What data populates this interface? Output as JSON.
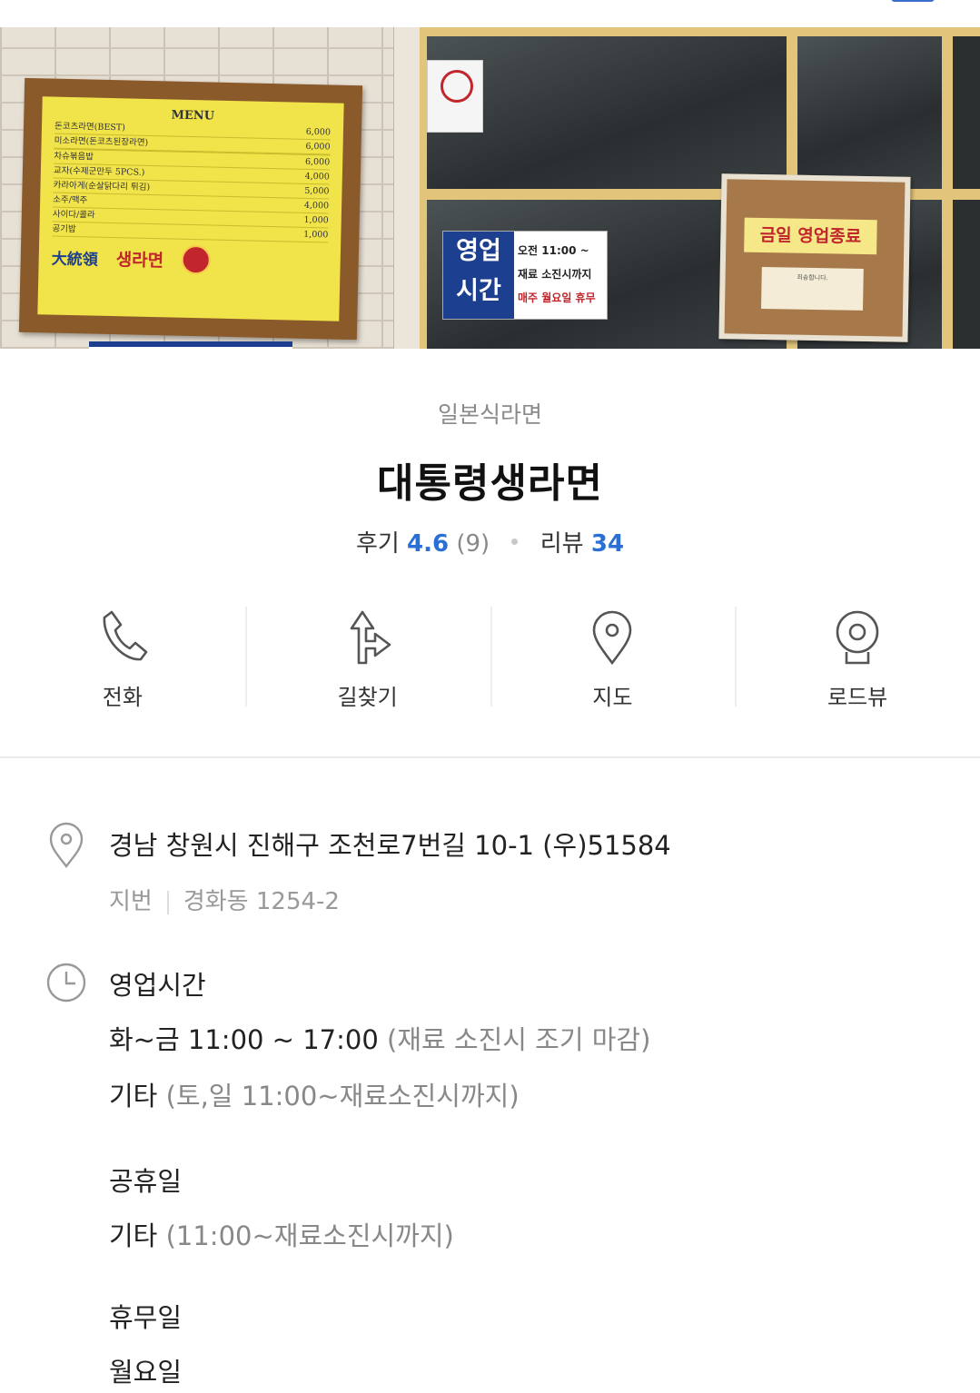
{
  "hero": {
    "menu_title": "MENU",
    "menu_items": [
      {
        "name": "돈코츠라면(BEST)",
        "price": "6,000"
      },
      {
        "name": "미소라면(돈코츠된장라면)",
        "price": "6,000"
      },
      {
        "name": "",
        "price": ""
      },
      {
        "name": "차슈볶음밥",
        "price": "6,000"
      },
      {
        "name": "교자(수제군만두 5PCS.)",
        "price": "4,000"
      },
      {
        "name": "카라아게(순살닭다리 튀김)",
        "price": "5,000"
      },
      {
        "name": "소주/맥주",
        "price": "4,000"
      },
      {
        "name": "사이다/콜라",
        "price": "1,000"
      },
      {
        "name": "공기밥",
        "price": "1,000"
      }
    ],
    "menu_brand_1": "大統領",
    "menu_brand_2": "생라면",
    "hours_sign_blue": "영업 시간",
    "hours_sign_line1": "오전 11:00 ~",
    "hours_sign_line2": "재료 소진시까지",
    "hours_sign_line3": "매주 월요일 휴무",
    "closed_sign": "금일 영업종료",
    "closed_note": "죄송합니다."
  },
  "place": {
    "category": "일본식라면",
    "name": "대통령생라면",
    "review_label": "후기",
    "review_score": "4.6",
    "review_count": "(9)",
    "blog_label": "리뷰",
    "blog_count": "34"
  },
  "actions": [
    {
      "label": "전화",
      "icon": "phone-icon"
    },
    {
      "label": "길찾기",
      "icon": "directions-icon"
    },
    {
      "label": "지도",
      "icon": "map-pin-icon"
    },
    {
      "label": "로드뷰",
      "icon": "roadview-icon"
    }
  ],
  "address": {
    "road": "경남 창원시 진해구 조천로7번길 10-1 (우)51584",
    "jibun_label": "지번",
    "jibun": "경화동 1254-2"
  },
  "hours": {
    "heading": "영업시간",
    "weekday_days": "화~금",
    "weekday_time": "11:00 ~ 17:00",
    "weekday_note": "(재료 소진시 조기 마감)",
    "other_label": "기타",
    "other_note": "(토,일 11:00~재료소진시까지)",
    "holiday_heading": "공휴일",
    "holiday_label": "기타",
    "holiday_note": "(11:00~재료소진시까지)",
    "closed_heading": "휴무일",
    "closed_day": "월요일"
  },
  "colors": {
    "accent_blue": "#2a6fd6",
    "icon_gray": "#666666"
  }
}
